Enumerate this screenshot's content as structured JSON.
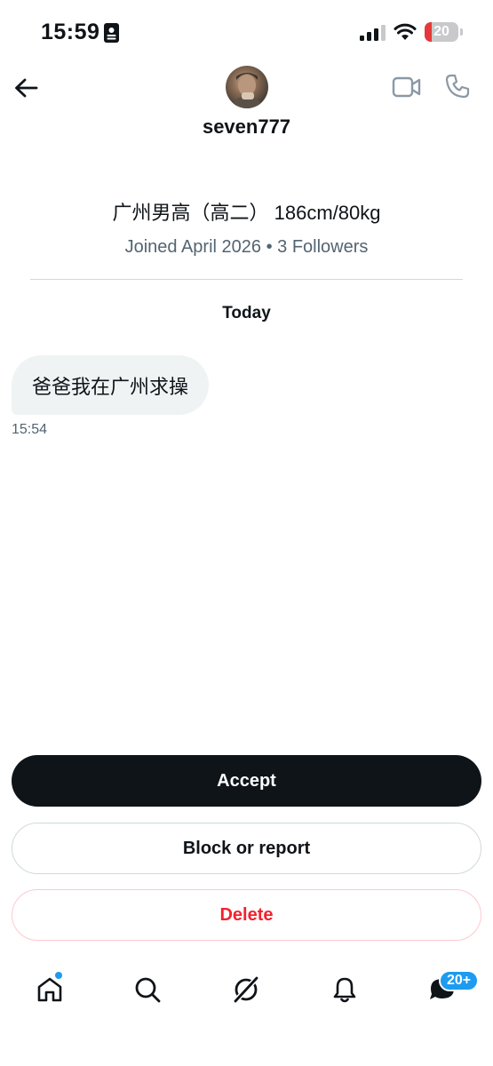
{
  "status_bar": {
    "time": "15:59",
    "battery_level": "20",
    "battery_fraction": 0.2,
    "icons": [
      "id-card-icon",
      "cellular-signal-icon",
      "wifi-icon",
      "battery-icon"
    ]
  },
  "header": {
    "username": "seven777",
    "back_icon": "back-arrow-icon",
    "video_icon": "video-camera-icon",
    "phone_icon": "phone-icon"
  },
  "profile": {
    "bio": "广州男高（高二） 186cm/80kg",
    "meta": "Joined April 2026 • 3 Followers"
  },
  "conversation": {
    "date_label": "Today",
    "messages": [
      {
        "text": "爸爸我在广州求操",
        "time": "15:54"
      }
    ]
  },
  "actions": {
    "accept_label": "Accept",
    "block_label": "Block or report",
    "delete_label": "Delete"
  },
  "bottom_nav": {
    "items": [
      "home-icon",
      "search-icon",
      "grok-icon",
      "notifications-icon",
      "messages-icon"
    ],
    "messages_badge": "20+"
  },
  "colors": {
    "text_primary": "#0f1419",
    "text_secondary": "#536471",
    "accent": "#1d9bf0",
    "danger": "#f4212e",
    "bubble_bg": "#eff3f4",
    "battery_low": "#e5383b"
  }
}
